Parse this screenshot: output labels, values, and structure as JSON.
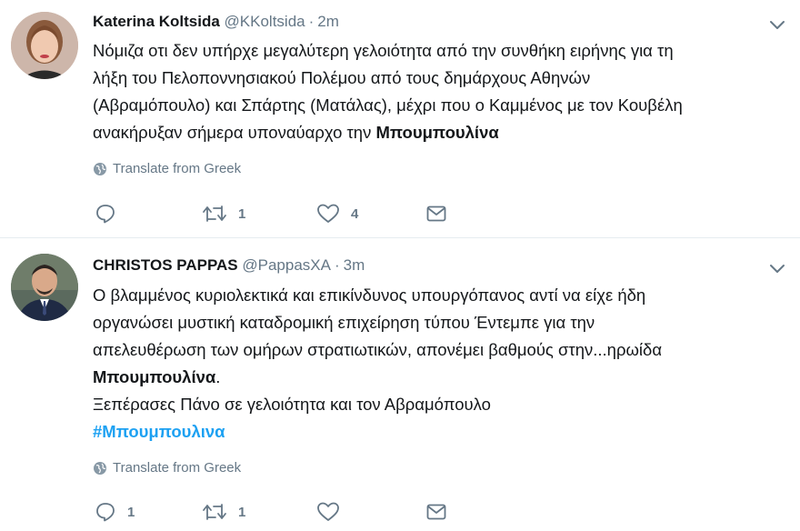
{
  "tweets": [
    {
      "name": "Katerina Koltsida",
      "handle": "@KKoltsida",
      "separator": "·",
      "time": "2m",
      "text_lines": [
        "Νόμιζα οτι δεν υπήρχε μεγαλύτερη γελοιότητα από την συνθήκη ειρήνης για τη",
        "λήξη του Πελοποννησιακού Πολέμου από τους δημάρχους Αθηνών",
        "(Αβραμόπουλο) και Σπάρτης (Ματάλας), μέχρι που ο Καμμένος με τον Κουβέλη",
        "ανακήρυξαν σήμερα υποναύαρχο την "
      ],
      "text_bold_end": "Μπουμπουλίνα",
      "translate_label": "Translate from Greek",
      "replies": "",
      "retweets": "1",
      "likes": "4"
    },
    {
      "name": "CHRISTOS PAPPAS",
      "handle": "@PappasXA",
      "separator": "·",
      "time": "3m",
      "text_lines": [
        "Ο βλαμμένος κυριολεκτικά και επικίνδυνος υπουργόπανος αντί να είχε ήδη",
        "οργανώσει μυστική καταδρομική επιχείρηση τύπου Έντεμπε για την",
        "απελευθέρωση  των ομήρων στρατιωτικών, απονέμει βαθμούς στην...ηρωίδα"
      ],
      "text_bold": "Μπουμπουλίνα",
      "text_bold_suffix": ".",
      "text_line_last": "Ξεπέρασες Πάνο σε γελοιότητα και τον Αβραμόπουλο",
      "hashtag": "#Μπουμπουλινα",
      "translate_label": "Translate from Greek",
      "replies": "1",
      "retweets": "1",
      "likes": ""
    }
  ],
  "icons": {
    "menu": "chevron-down-icon",
    "translate": "globe-icon",
    "reply": "reply-icon",
    "retweet": "retweet-icon",
    "like": "heart-icon",
    "dm": "envelope-icon"
  },
  "colors": {
    "text": "#14171a",
    "secondary": "#657786",
    "link": "#1da1f2",
    "divider": "#e6ecf0"
  }
}
